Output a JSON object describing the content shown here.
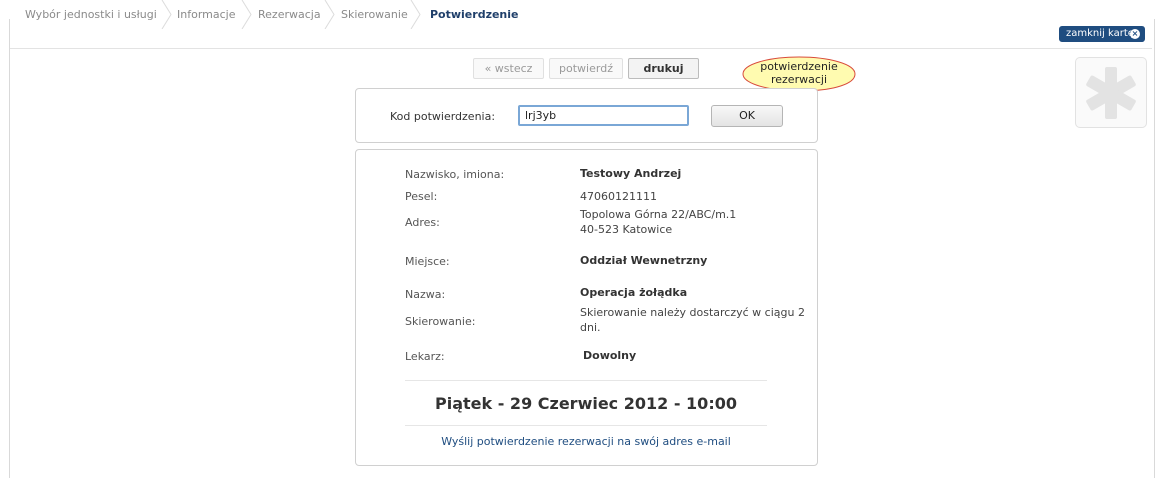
{
  "breadcrumb": [
    {
      "label": "Wybór jednostki i usługi"
    },
    {
      "label": "Informacje"
    },
    {
      "label": "Rezerwacja"
    },
    {
      "label": "Skierowanie"
    },
    {
      "label": "Potwierdzenie"
    }
  ],
  "header": {
    "close_card_label": "zamknij kartę"
  },
  "toolbar": {
    "back_label": "« wstecz",
    "confirm_label": "potwierdź",
    "print_label": "drukuj"
  },
  "tooltip": {
    "line1": "potwierdzenie",
    "line2": "rezerwacji"
  },
  "code_form": {
    "label": "Kod potwierdzenia:",
    "value": "lrj3yb",
    "ok_label": "OK"
  },
  "details": {
    "name_label": "Nazwisko, imiona:",
    "name_value": "Testowy Andrzej",
    "pesel_label": "Pesel:",
    "pesel_value": "47060121111",
    "address_label": "Adres:",
    "address_line1": "Topolowa Górna 22/ABC/m.1",
    "address_line2": "40-523 Katowice",
    "place_label": "Miejsce:",
    "place_value": "Oddział Wewnetrzny",
    "service_label": "Nazwa:",
    "service_value": "Operacja żołądka",
    "referral_label": "Skierowanie:",
    "referral_line1": "Skierowanie należy dostarczyć w ciągu 2",
    "referral_line2": "dni.",
    "doctor_label": "Lekarz:",
    "doctor_value": "Dowolny"
  },
  "appointment": {
    "datetime": "Piątek - 29 Czerwiec 2012 - 10:00"
  },
  "email_link": "Wyślij potwierdzenie rezerwacji na swój adres e-mail",
  "colors": {
    "brand": "#1f4d80",
    "active_crumb": "#1f3f6a",
    "bubble_fill": "#fffbb0",
    "bubble_stroke": "#d84a3a"
  }
}
